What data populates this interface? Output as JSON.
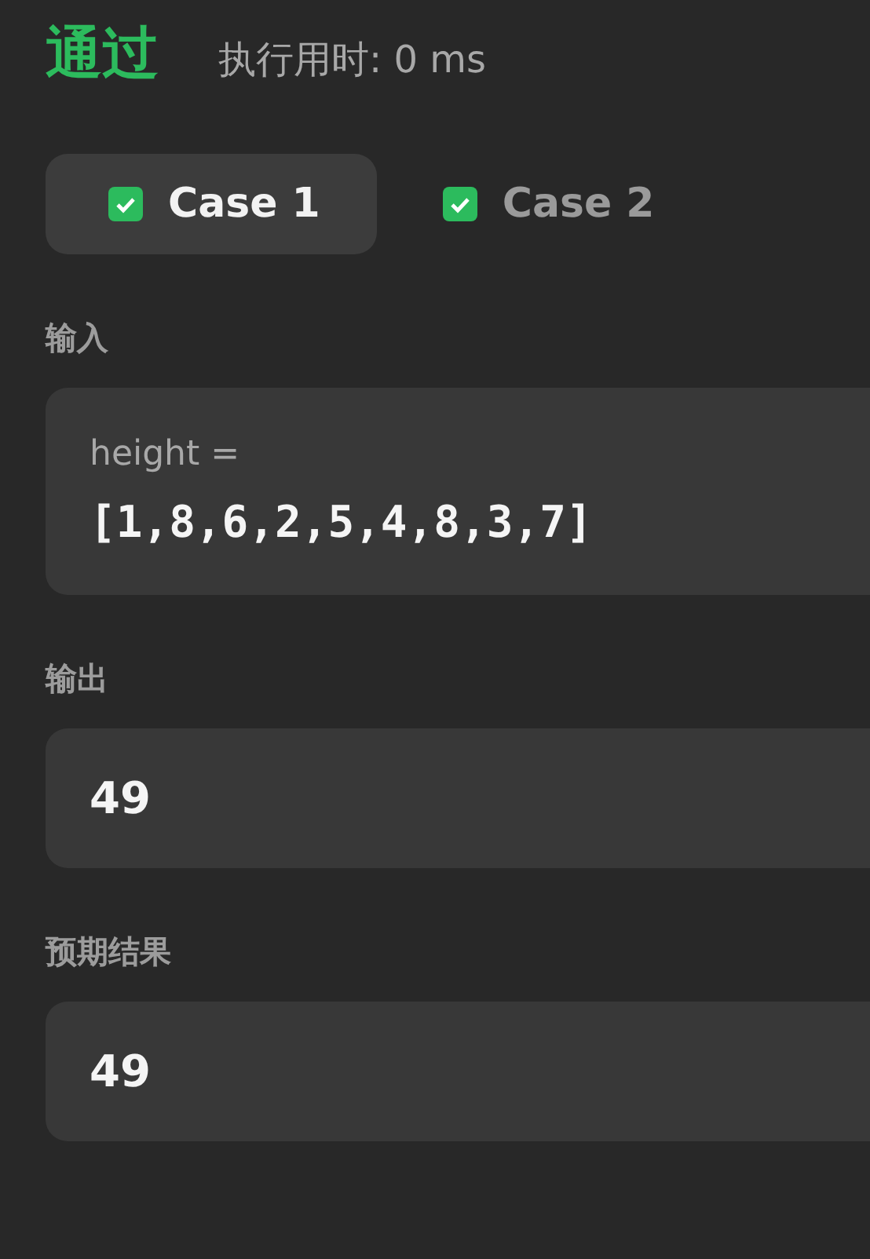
{
  "result": {
    "status": "通过",
    "runtime": "执行用时: 0 ms"
  },
  "cases": [
    {
      "label": "Case 1",
      "selected": true,
      "passed": true
    },
    {
      "label": "Case 2",
      "selected": false,
      "passed": true
    }
  ],
  "sections": [
    {
      "kind": "input",
      "title": "输入",
      "variable": "height =",
      "value": "[1,8,6,2,5,4,8,3,7]"
    },
    {
      "kind": "output",
      "title": "输出",
      "value": "49"
    },
    {
      "kind": "output",
      "title": "预期结果",
      "value": "49"
    }
  ]
}
